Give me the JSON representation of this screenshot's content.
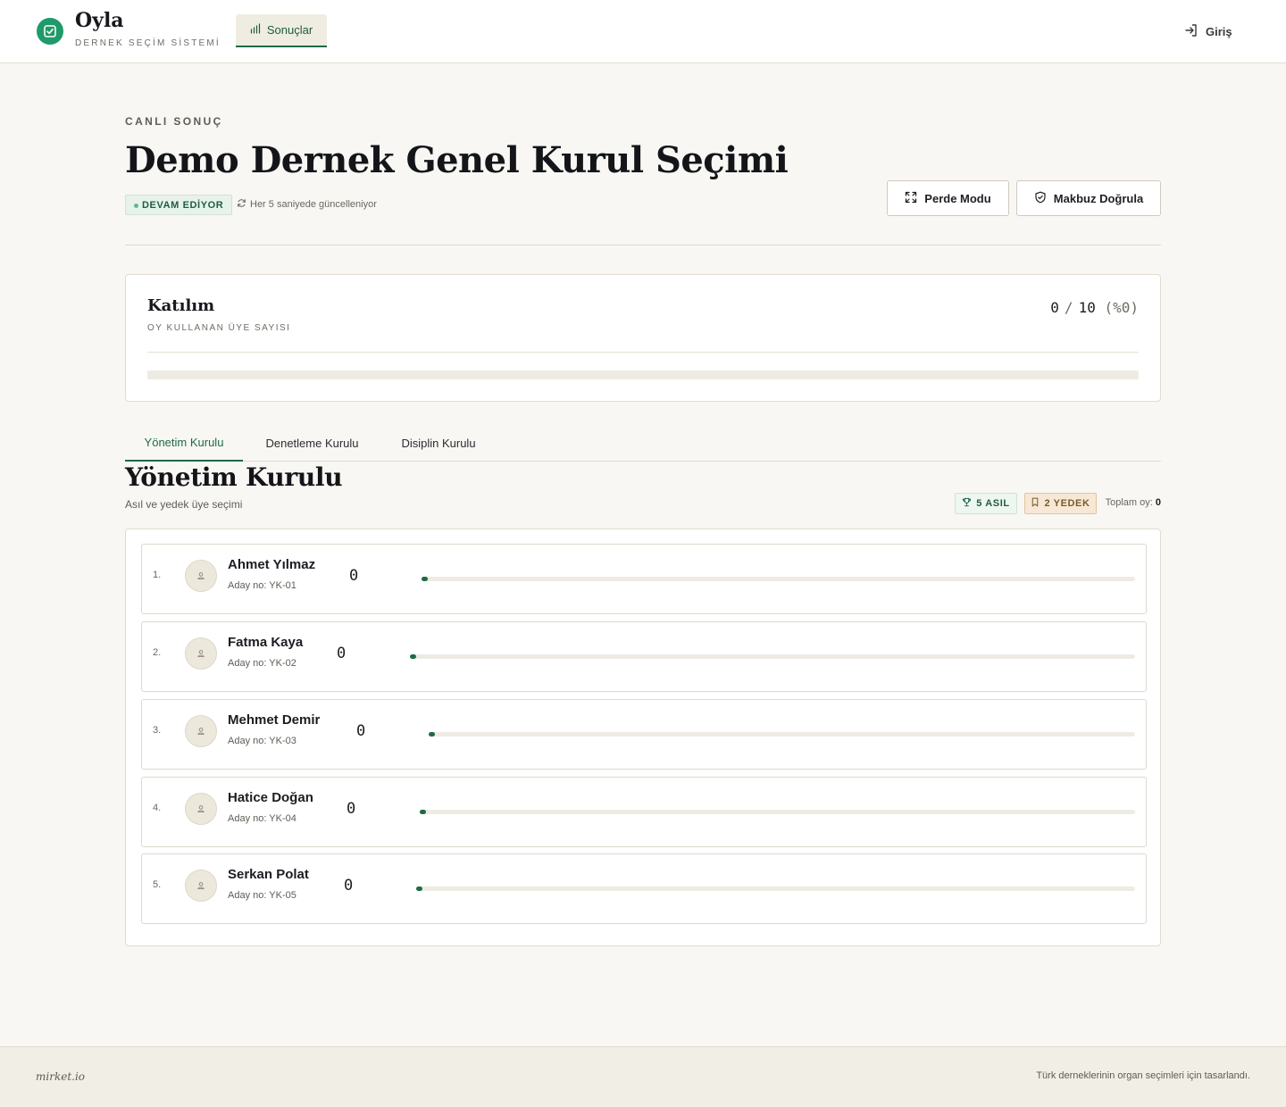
{
  "brand": {
    "name": "Oyla",
    "subtitle": "DERNEK SEÇİM SİSTEMİ"
  },
  "nav": {
    "results_label": "Sonuçlar",
    "login_label": "Giriş"
  },
  "hero": {
    "eyebrow": "CANLI SONUÇ",
    "title": "Demo Dernek Genel Kurul Seçimi",
    "status": "DEVAM EDİYOR",
    "refresh_note": "Her 5 saniyede güncelleniyor",
    "curtain_button": "Perde Modu",
    "receipt_button": "Makbuz Doğrula"
  },
  "participation": {
    "title": "Katılım",
    "subtitle": "OY KULLANAN ÜYE SAYISI",
    "voted": "0",
    "total": "10",
    "percent_label": "(%0)",
    "fraction": 0
  },
  "tabs": [
    "Yönetim Kurulu",
    "Denetleme Kurulu",
    "Disiplin Kurulu"
  ],
  "section": {
    "title": "Yönetim Kurulu",
    "subtitle": "Asıl ve yedek üye seçimi",
    "main_badge": "5 ASIL",
    "reserve_badge": "2 YEDEK",
    "total_label": "Toplam oy:",
    "total_value": "0"
  },
  "candidates": [
    {
      "rank": "1.",
      "name": "Ahmet Yılmaz",
      "number": "Aday no: YK-01",
      "votes": "0",
      "share": 0
    },
    {
      "rank": "2.",
      "name": "Fatma Kaya",
      "number": "Aday no: YK-02",
      "votes": "0",
      "share": 0
    },
    {
      "rank": "3.",
      "name": "Mehmet Demir",
      "number": "Aday no: YK-03",
      "votes": "0",
      "share": 0
    },
    {
      "rank": "4.",
      "name": "Hatice Doğan",
      "number": "Aday no: YK-04",
      "votes": "0",
      "share": 0
    },
    {
      "rank": "5.",
      "name": "Serkan Polat",
      "number": "Aday no: YK-05",
      "votes": "0",
      "share": 0
    }
  ],
  "footer": {
    "left": "mirket.io",
    "right": "Türk derneklerinin organ seçimleri için tasarlandı."
  },
  "colors": {
    "accent": "#1e6b45",
    "brand": "#1f9a6a",
    "background": "#f8f7f3"
  },
  "icons": {
    "logo": "check-square-icon",
    "results": "bar-chart-icon",
    "login": "log-in-icon",
    "refresh": "refresh-icon",
    "curtain": "expand-icon",
    "receipt": "shield-check-icon",
    "main": "trophy-icon",
    "reserve": "bookmark-icon",
    "candidate": "user-icon"
  }
}
